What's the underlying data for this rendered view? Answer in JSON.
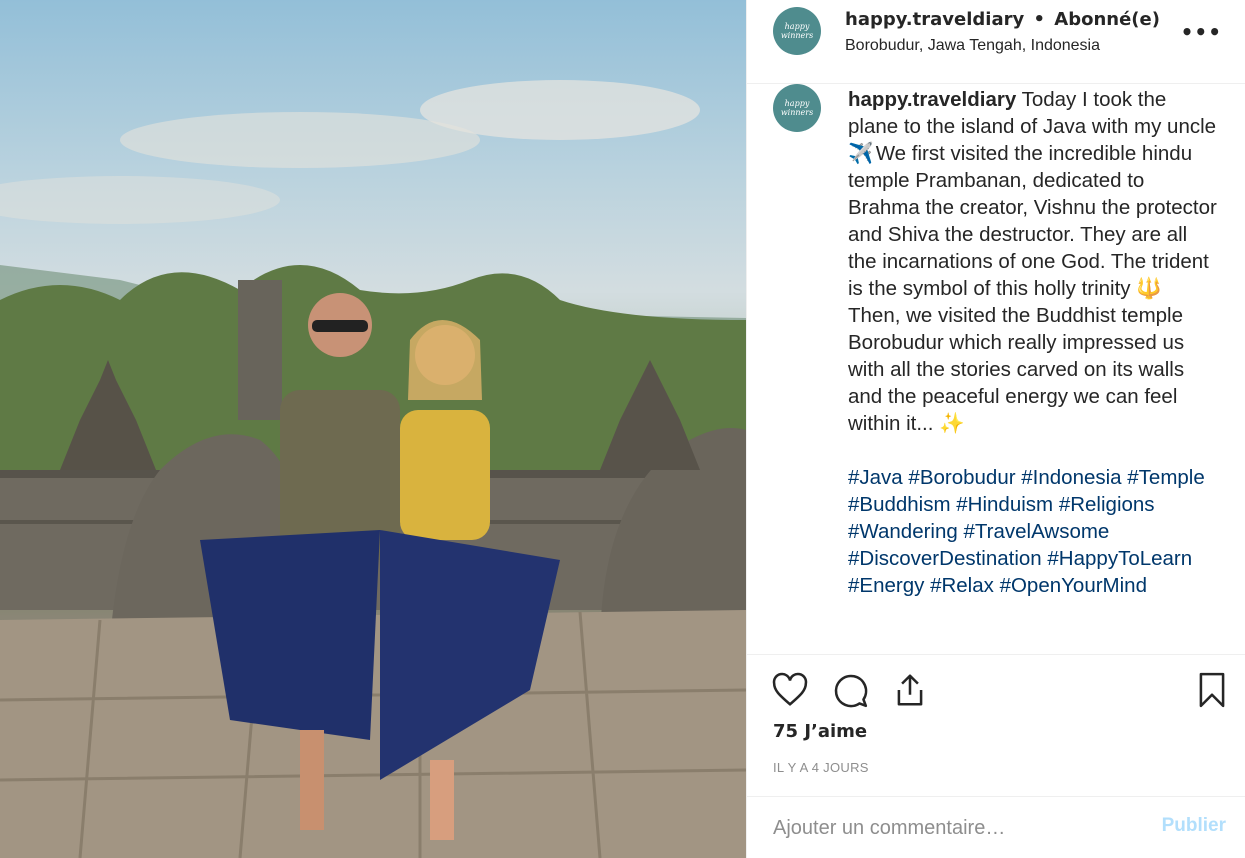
{
  "post": {
    "username": "happy.traveldiary",
    "follow_status": "Abonné(e)",
    "separator": "•",
    "location": "Borobudur, Jawa Tengah, Indonesia",
    "avatar_text": [
      "happy",
      "winners"
    ],
    "more_icon": "more-options-icon"
  },
  "caption": {
    "username": "happy.traveldiary",
    "text_part1": "Today I took the plane to the island of Java with my uncle",
    "emoji1": "✈️",
    "text_part2": "We first visited the incredible hindu temple Prambanan, dedicated to Brahma the creator, Vishnu the protector and Shiva the destructor. They are all the incarnations of one God. The trident is the symbol of this holly trinity",
    "emoji2": "🔱",
    "text_part3": "Then, we visited the Buddhist temple Borobudur which really impressed us with all the stories carved on its walls and the peaceful energy we can feel within it...",
    "emoji3": "✨",
    "hashtags": [
      "#Java",
      "#Borobudur",
      "#Indonesia",
      "#Temple",
      "#Buddhism",
      "#Hinduism",
      "#Religions",
      "#Wandering",
      "#TravelAwsome",
      "#DiscoverDestination",
      "#HappyToLearn",
      "#Energy",
      "#Relax",
      "#OpenYourMind"
    ]
  },
  "actions": {
    "icons": [
      "heart-icon",
      "comment-icon",
      "share-icon",
      "bookmark-icon"
    ]
  },
  "likes": "75 J’aime",
  "time_ago": "IL Y A 4 JOURS",
  "comment": {
    "placeholder": "Ajouter un commentaire…",
    "value": "",
    "post_label": "Publier"
  },
  "colors": {
    "hashtag": "#00376b",
    "post_disabled": "#b2dffc",
    "avatar_bg": "#4f8c8e",
    "muted": "#8e8e8e"
  }
}
